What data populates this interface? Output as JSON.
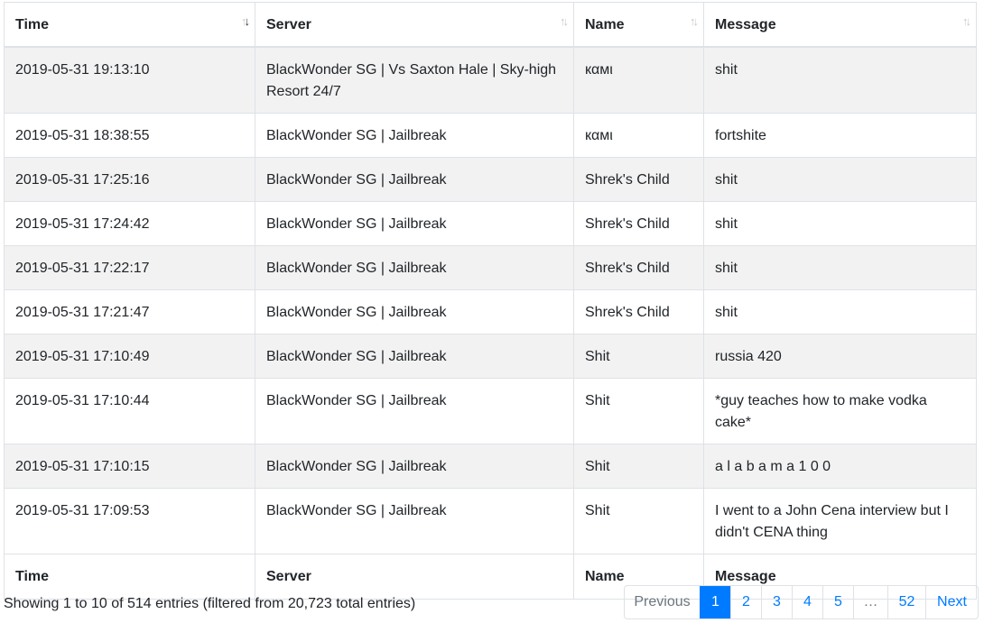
{
  "table": {
    "headers": [
      {
        "label": "Time",
        "sort": "desc"
      },
      {
        "label": "Server",
        "sort": "none"
      },
      {
        "label": "Name",
        "sort": "none"
      },
      {
        "label": "Message",
        "sort": "none"
      }
    ],
    "rows": [
      {
        "time": "2019-05-31 19:13:10",
        "server": "BlackWonder SG | Vs Saxton Hale | Sky-high Resort 24/7",
        "name": "кαмι",
        "message": "shit"
      },
      {
        "time": "2019-05-31 18:38:55",
        "server": "BlackWonder SG | Jailbreak",
        "name": "кαмι",
        "message": "fortshite"
      },
      {
        "time": "2019-05-31 17:25:16",
        "server": "BlackWonder SG | Jailbreak",
        "name": "Shrek's Child",
        "message": "shit"
      },
      {
        "time": "2019-05-31 17:24:42",
        "server": "BlackWonder SG | Jailbreak",
        "name": "Shrek's Child",
        "message": "shit"
      },
      {
        "time": "2019-05-31 17:22:17",
        "server": "BlackWonder SG | Jailbreak",
        "name": "Shrek's Child",
        "message": "shit"
      },
      {
        "time": "2019-05-31 17:21:47",
        "server": "BlackWonder SG | Jailbreak",
        "name": "Shrek's Child",
        "message": "shit"
      },
      {
        "time": "2019-05-31 17:10:49",
        "server": "BlackWonder SG | Jailbreak",
        "name": "Shit",
        "message": "russia 420"
      },
      {
        "time": "2019-05-31 17:10:44",
        "server": "BlackWonder SG | Jailbreak",
        "name": "Shit",
        "message": "*guy teaches how to make vodka cake*"
      },
      {
        "time": "2019-05-31 17:10:15",
        "server": "BlackWonder SG | Jailbreak",
        "name": "Shit",
        "message": "a l a b a m a 1 0 0"
      },
      {
        "time": "2019-05-31 17:09:53",
        "server": "BlackWonder SG | Jailbreak",
        "name": "Shit",
        "message": "I went to a John Cena interview but I didn't CENA thing"
      }
    ],
    "footers": [
      "Time",
      "Server",
      "Name",
      "Message"
    ]
  },
  "info": "Showing 1 to 10 of 514 entries (filtered from 20,723 total entries)",
  "pagination": {
    "previous": "Previous",
    "pages": [
      "1",
      "2",
      "3",
      "4",
      "5",
      "…",
      "52"
    ],
    "active_page": "1",
    "next": "Next"
  },
  "colors": {
    "accent": "#007bff",
    "stripe": "#f2f2f2",
    "border": "#dee2e6"
  }
}
